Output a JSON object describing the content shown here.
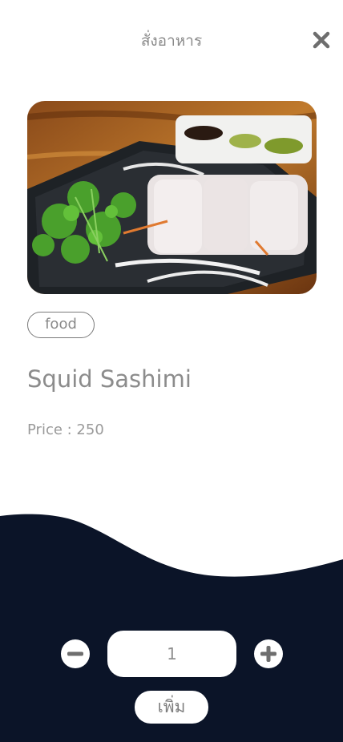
{
  "header": {
    "title": "สั่งอาหาร",
    "close_icon": "close-icon"
  },
  "item": {
    "image_alt": "squid sashimi dish",
    "tag": "food",
    "name": "Squid Sashimi",
    "price_label": "Price : ",
    "price_value": "250"
  },
  "order": {
    "quantity": "1",
    "minus_icon": "minus-circle-icon",
    "plus_icon": "plus-circle-icon",
    "add_label": "เพิ่ม"
  },
  "colors": {
    "background": "#ffffff",
    "footer_navy": "#0b1428",
    "text_gray": "#8a8a8a",
    "icon_gray": "#6e6e6e"
  }
}
